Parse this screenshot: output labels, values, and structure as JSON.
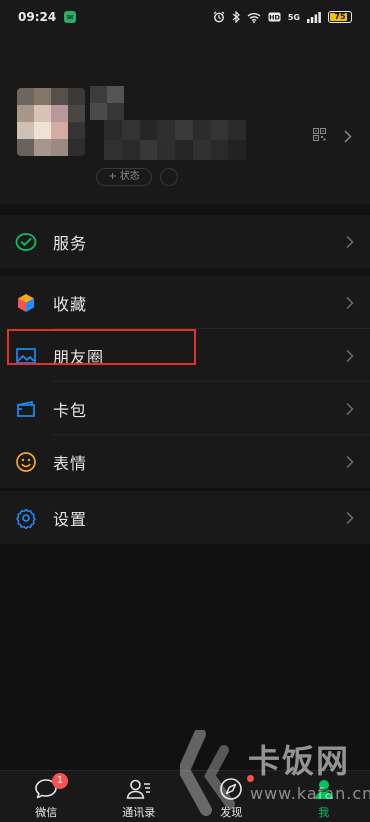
{
  "status_bar": {
    "time": "09:24",
    "battery": "75",
    "network": "5G"
  },
  "profile": {
    "status_label": "+ 状态"
  },
  "menu": {
    "services": {
      "label": "服务",
      "icon": "services-check-icon",
      "color": "#07c160"
    },
    "favorites": {
      "label": "收藏",
      "icon": "favorites-cube-icon"
    },
    "moments": {
      "label": "朋友圈",
      "icon": "moments-image-icon",
      "color": "#1e8fff"
    },
    "cards": {
      "label": "卡包",
      "icon": "card-wallet-icon",
      "color": "#1e8fff"
    },
    "stickers": {
      "label": "表情",
      "icon": "sticker-smile-icon",
      "color": "#f5a623"
    },
    "settings": {
      "label": "设置",
      "icon": "settings-gear-icon",
      "color": "#1e8fff"
    }
  },
  "bottom_nav": {
    "chats": {
      "label": "微信",
      "badge": "1"
    },
    "contacts": {
      "label": "通讯录"
    },
    "discover": {
      "label": "发现"
    },
    "me": {
      "label": "我"
    }
  },
  "watermark": {
    "text": "卡饭网",
    "url": "www.kafan.cn"
  },
  "colors": {
    "accent": "#07c160",
    "highlight": "#e0312b",
    "badge": "#fa5151"
  }
}
